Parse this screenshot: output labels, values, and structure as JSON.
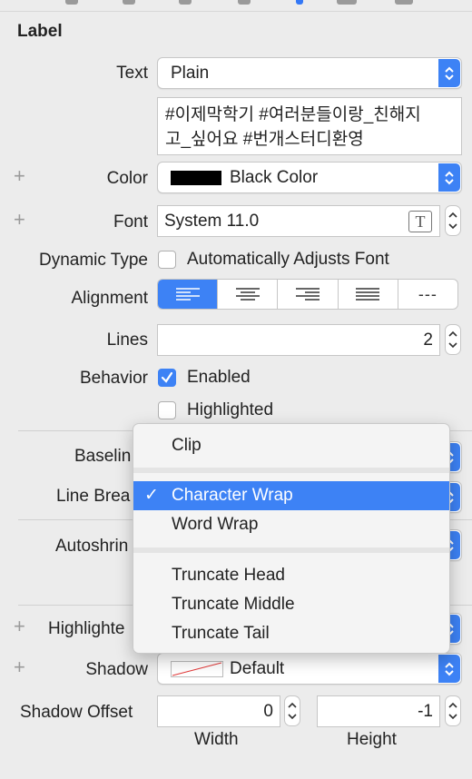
{
  "section": {
    "title": "Label"
  },
  "text_row": {
    "label": "Text",
    "type_value": "Plain",
    "content_line1": "#이제막학기 #여러분들이랑_친해지",
    "content_line2": "고_싶어요 #번개스터디환영"
  },
  "color_row": {
    "label": "Color",
    "value": "Black Color",
    "swatch": "#000000"
  },
  "font_row": {
    "label": "Font",
    "value": "System 11.0",
    "icon": "T"
  },
  "dynamic_type": {
    "label": "Dynamic Type",
    "checkbox_label": "Automatically Adjusts Font",
    "checked": false
  },
  "alignment": {
    "label": "Alignment",
    "options": [
      "left",
      "center",
      "right",
      "justified",
      "natural"
    ],
    "natural_glyph": "---",
    "selected": "left"
  },
  "lines": {
    "label": "Lines",
    "value": "2"
  },
  "behavior": {
    "label": "Behavior",
    "enabled_label": "Enabled",
    "enabled": true,
    "highlighted_label": "Highlighted",
    "highlighted": false
  },
  "baseline": {
    "label": "Baselin"
  },
  "line_break": {
    "label": "Line Brea"
  },
  "autoshrink": {
    "label": "Autoshrin"
  },
  "highlighted_row": {
    "label": "Highlighte"
  },
  "shadow": {
    "label": "Shadow",
    "value": "Default"
  },
  "shadow_offset": {
    "label": "Shadow Offset",
    "width_value": "0",
    "height_value": "-1",
    "width_caption": "Width",
    "height_caption": "Height"
  },
  "menu": {
    "items": [
      "Clip",
      "Character Wrap",
      "Word Wrap",
      "Truncate Head",
      "Truncate Middle",
      "Truncate Tail"
    ],
    "selected": "Character Wrap",
    "check": "✓"
  },
  "colors": {
    "accent": "#3d82f5",
    "panel": "#ececec"
  }
}
